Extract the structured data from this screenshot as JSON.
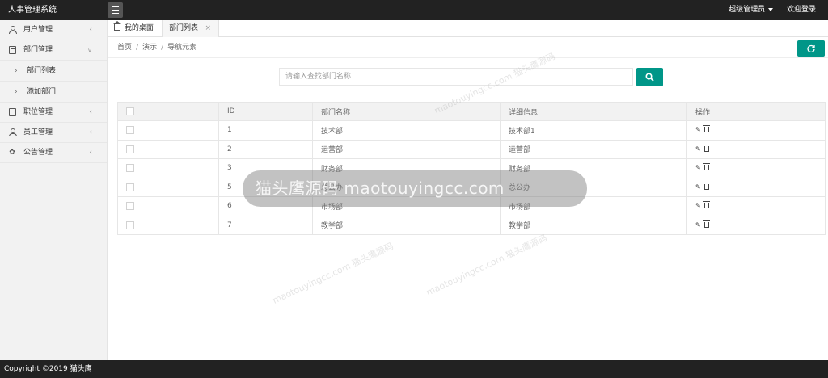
{
  "header": {
    "logo": "人事管理系统",
    "admin": "超级管理员",
    "welcome": "欢迎登录"
  },
  "sidebar": {
    "items": [
      {
        "label": "用户管理",
        "icon": "user-icon"
      },
      {
        "label": "部门管理",
        "icon": "department-icon",
        "expanded": true,
        "children": [
          {
            "label": "部门列表"
          },
          {
            "label": "添加部门"
          }
        ]
      },
      {
        "label": "职位管理",
        "icon": "position-icon"
      },
      {
        "label": "员工管理",
        "icon": "staff-icon"
      },
      {
        "label": "公告管理",
        "icon": "notice-icon"
      }
    ]
  },
  "tabs": [
    {
      "label": "我的桌面"
    },
    {
      "label": "部门列表",
      "close": "×"
    }
  ],
  "breadcrumb": [
    "首页",
    "演示",
    "导航元素"
  ],
  "search": {
    "placeholder": "请输入查找部门名称",
    "value": ""
  },
  "table": {
    "columns": [
      "ID",
      "部门名称",
      "详细信息",
      "操作"
    ],
    "rows": [
      {
        "id": "1",
        "name": "技术部",
        "detail": "技术部1"
      },
      {
        "id": "2",
        "name": "运营部",
        "detail": "运营部"
      },
      {
        "id": "3",
        "name": "财务部",
        "detail": "财务部"
      },
      {
        "id": "5",
        "name": "总公办",
        "detail": "总公办"
      },
      {
        "id": "6",
        "name": "市场部",
        "detail": "市场部"
      },
      {
        "id": "7",
        "name": "教学部",
        "detail": "教学部"
      }
    ]
  },
  "watermark": {
    "main": "猫头鹰源码 maotouyingcc.com",
    "faint": "maotouyingcc.com 猫头鹰源码"
  },
  "footer": {
    "copyright": "Copyright ©2019 猫头鹰"
  },
  "colors": {
    "accent": "#009688",
    "header_bg": "#222222"
  }
}
